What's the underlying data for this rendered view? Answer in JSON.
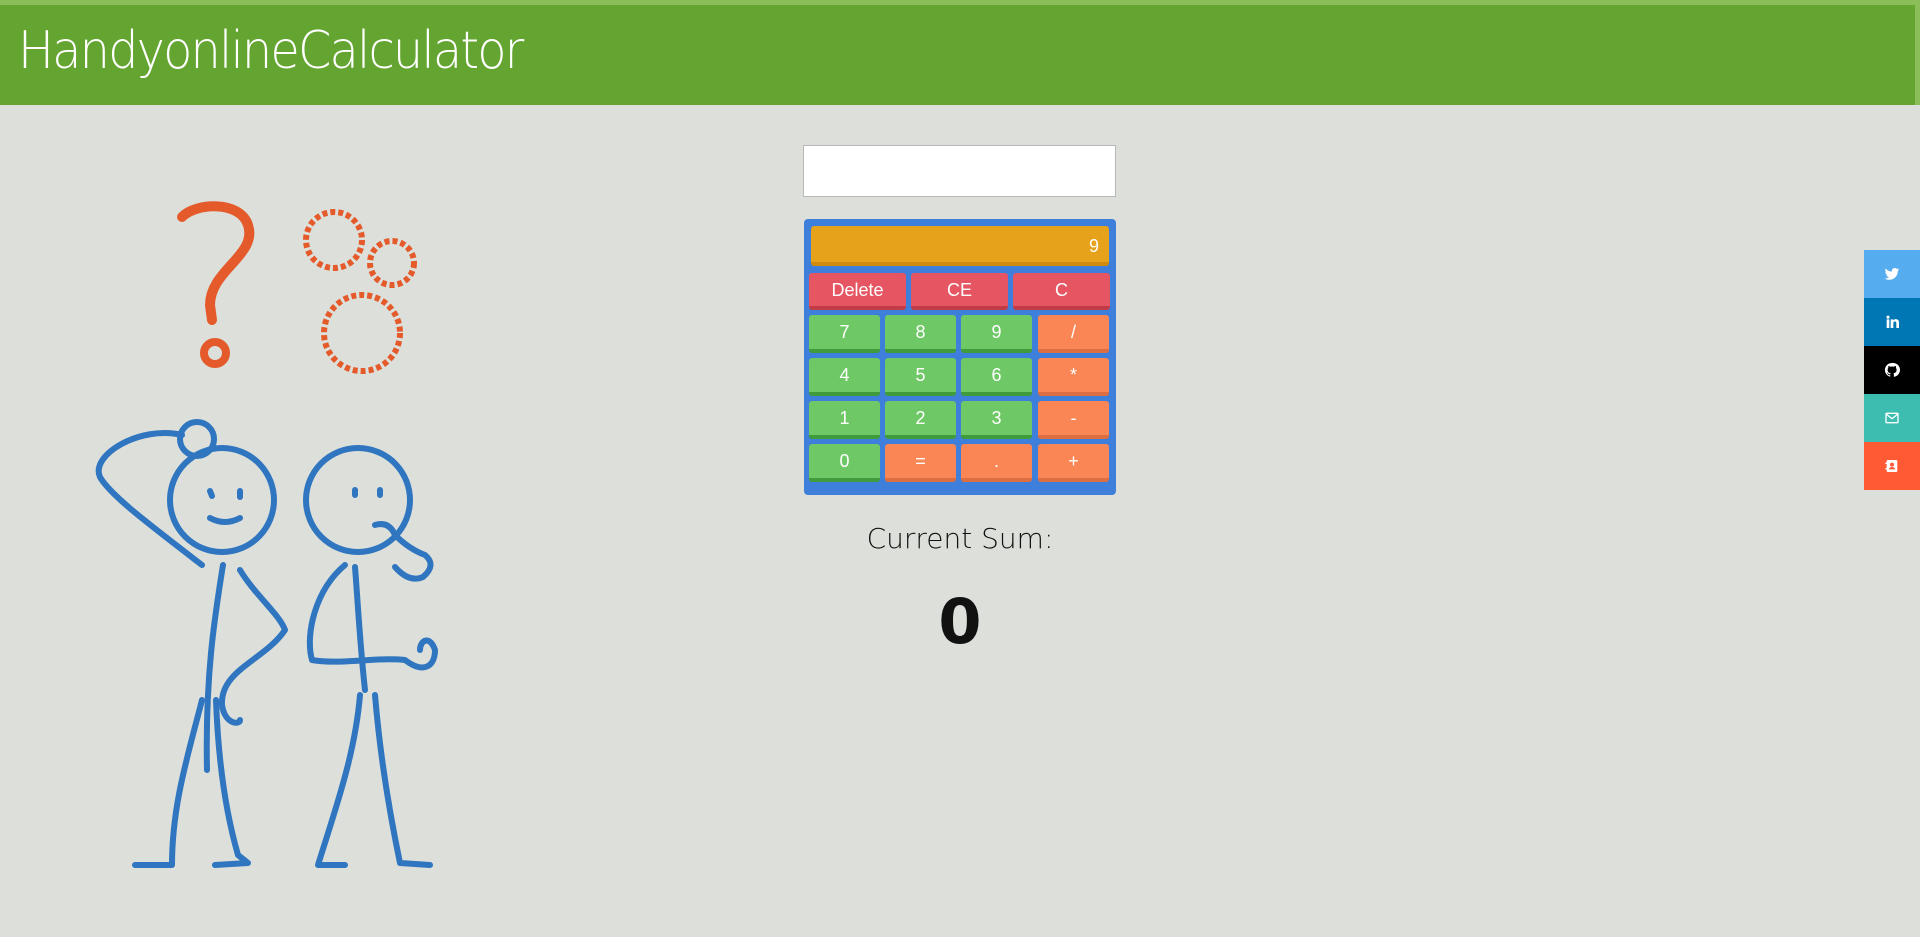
{
  "header": {
    "title": "HandyonlineCalculator"
  },
  "search": {
    "value": "",
    "placeholder": ""
  },
  "calculator": {
    "display": "9",
    "top_row": [
      "Delete",
      "CE",
      "C"
    ],
    "rows": [
      [
        "7",
        "8",
        "9",
        "/"
      ],
      [
        "4",
        "5",
        "6",
        "*"
      ],
      [
        "1",
        "2",
        "3",
        "-"
      ],
      [
        "0",
        "=",
        ".",
        "+"
      ]
    ]
  },
  "sum": {
    "label": "Current Sum:",
    "value": "0"
  },
  "social": [
    {
      "icon": "twitter-icon",
      "color": "#55acee"
    },
    {
      "icon": "linkedin-icon",
      "color": "#0077b5"
    },
    {
      "icon": "github-icon",
      "color": "#000000"
    },
    {
      "icon": "email-icon",
      "color": "#3cbdb0"
    },
    {
      "icon": "contact-card-icon",
      "color": "#ff5a34"
    }
  ],
  "colors": {
    "header": "#64a430",
    "background": "#dcdfda",
    "calc_frame": "#3f7fdc",
    "display": "#e5a21a",
    "red_key": "#e55662",
    "green_key": "#6fc866",
    "orange_key": "#fb8655",
    "illustration_people": "#2f75bf",
    "illustration_symbols": "#e45a2a"
  }
}
